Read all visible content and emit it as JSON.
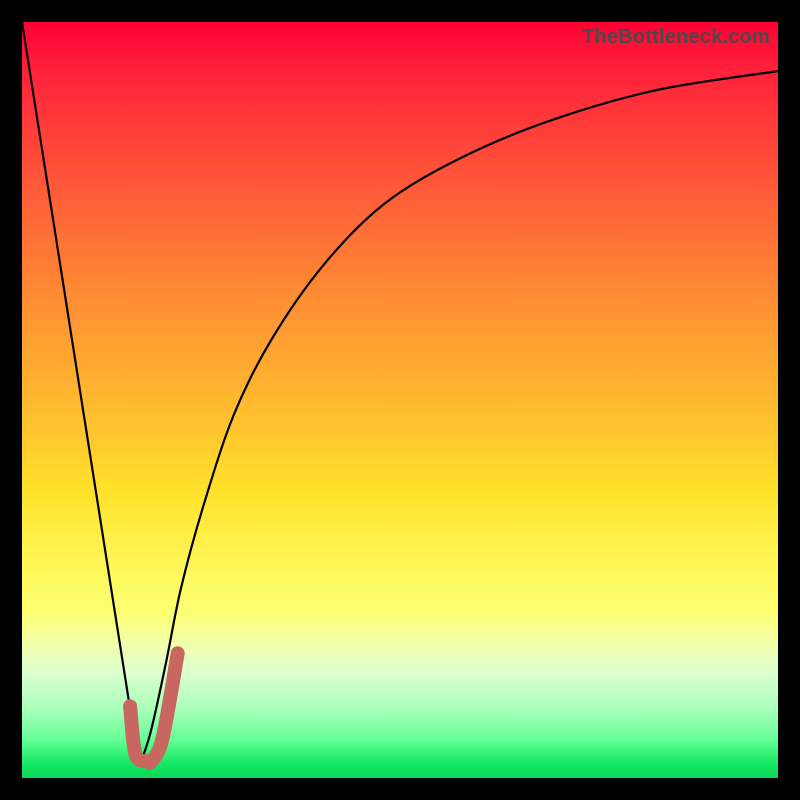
{
  "watermark": "TheBottleneck.com",
  "colors": {
    "frame": "#000000",
    "gradient_top": "#ff0033",
    "gradient_bottom": "#08d657",
    "curve": "#000000",
    "marker": "#c76760"
  },
  "chart_data": {
    "type": "line",
    "title": "",
    "xlabel": "",
    "ylabel": "",
    "xlim": [
      0,
      100
    ],
    "ylim": [
      0,
      100
    ],
    "grid": false,
    "legend": false,
    "series": [
      {
        "name": "left-branch",
        "x": [
          0,
          15.5
        ],
        "y": [
          100,
          1.5
        ]
      },
      {
        "name": "right-branch",
        "x": [
          15.5,
          17,
          19,
          21,
          24,
          28,
          33,
          40,
          48,
          58,
          70,
          84,
          100
        ],
        "y": [
          1.5,
          6,
          15,
          25,
          36,
          48,
          58,
          68,
          76,
          82,
          87,
          91,
          93.5
        ]
      },
      {
        "name": "marker-hook",
        "x": [
          14.3,
          15.0,
          16.5,
          17.2,
          18.6,
          20.6
        ],
        "y": [
          9.5,
          3.2,
          2.2,
          2.3,
          5.3,
          16.5
        ]
      }
    ],
    "annotations": []
  }
}
